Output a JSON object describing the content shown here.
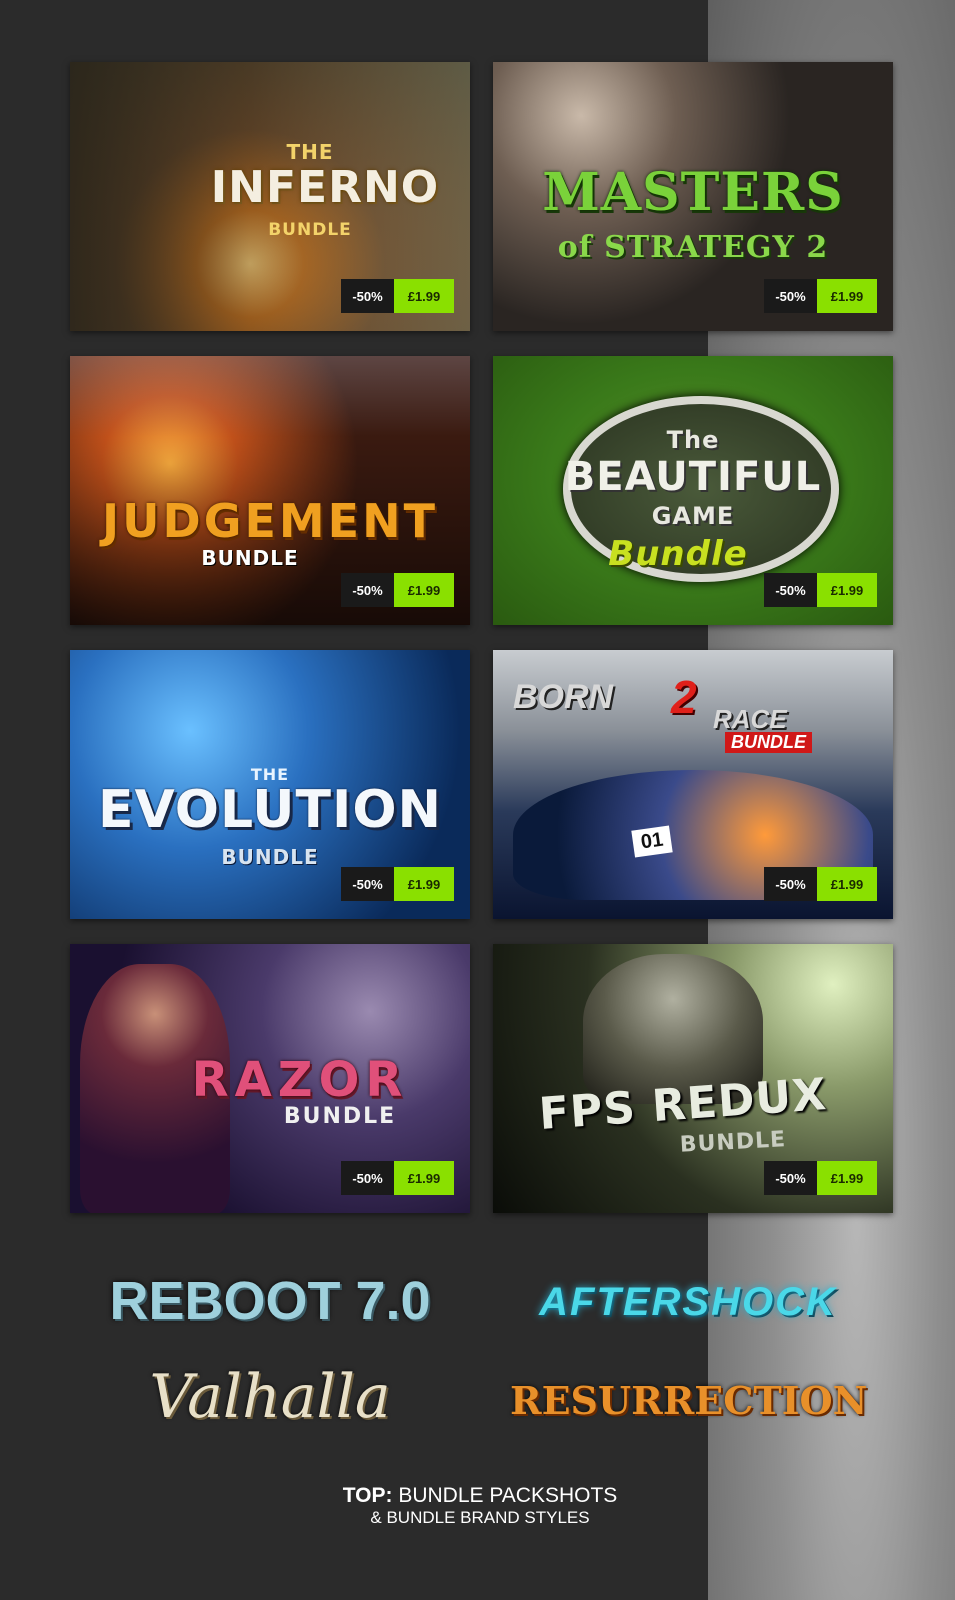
{
  "tiles": [
    {
      "top_text": "THE",
      "title": "INFERNO",
      "sub": "BUNDLE",
      "discount": "-50%",
      "price": "£1.99"
    },
    {
      "top_text": "",
      "title": "MASTERS",
      "sub": "of STRATEGY 2",
      "discount": "-50%",
      "price": "£1.99"
    },
    {
      "top_text": "",
      "title": "JUDGEMENT",
      "sub": "BUNDLE",
      "discount": "-50%",
      "price": "£1.99"
    },
    {
      "top_text": "The",
      "title": "BEAUTIFUL",
      "sub": "GAME",
      "extra": "Bundle",
      "discount": "-50%",
      "price": "£1.99"
    },
    {
      "top_text": "THE",
      "title": "EVOLUTION",
      "sub": "BUNDLE",
      "discount": "-50%",
      "price": "£1.99"
    },
    {
      "top_text": "BORN",
      "title": "2",
      "sub": "RACE",
      "extra": "BUNDLE",
      "plate": "01",
      "discount": "-50%",
      "price": "£1.99"
    },
    {
      "top_text": "",
      "title": "RAZOR",
      "sub": "BUNDLE",
      "discount": "-50%",
      "price": "£1.99"
    },
    {
      "top_text": "",
      "title": "FPS REDUX",
      "sub": "BUNDLE",
      "discount": "-50%",
      "price": "£1.99"
    }
  ],
  "brands": {
    "reboot": "REBOOT 7.0",
    "aftershock": "AFTERSHOCK",
    "valhalla": "Valhalla",
    "resurrection": "RESURRECTION"
  },
  "caption": {
    "bold": "TOP:",
    "line1": " BUNDLE PACKSHOTS",
    "line2": "& BUNDLE BRAND STYLES"
  }
}
